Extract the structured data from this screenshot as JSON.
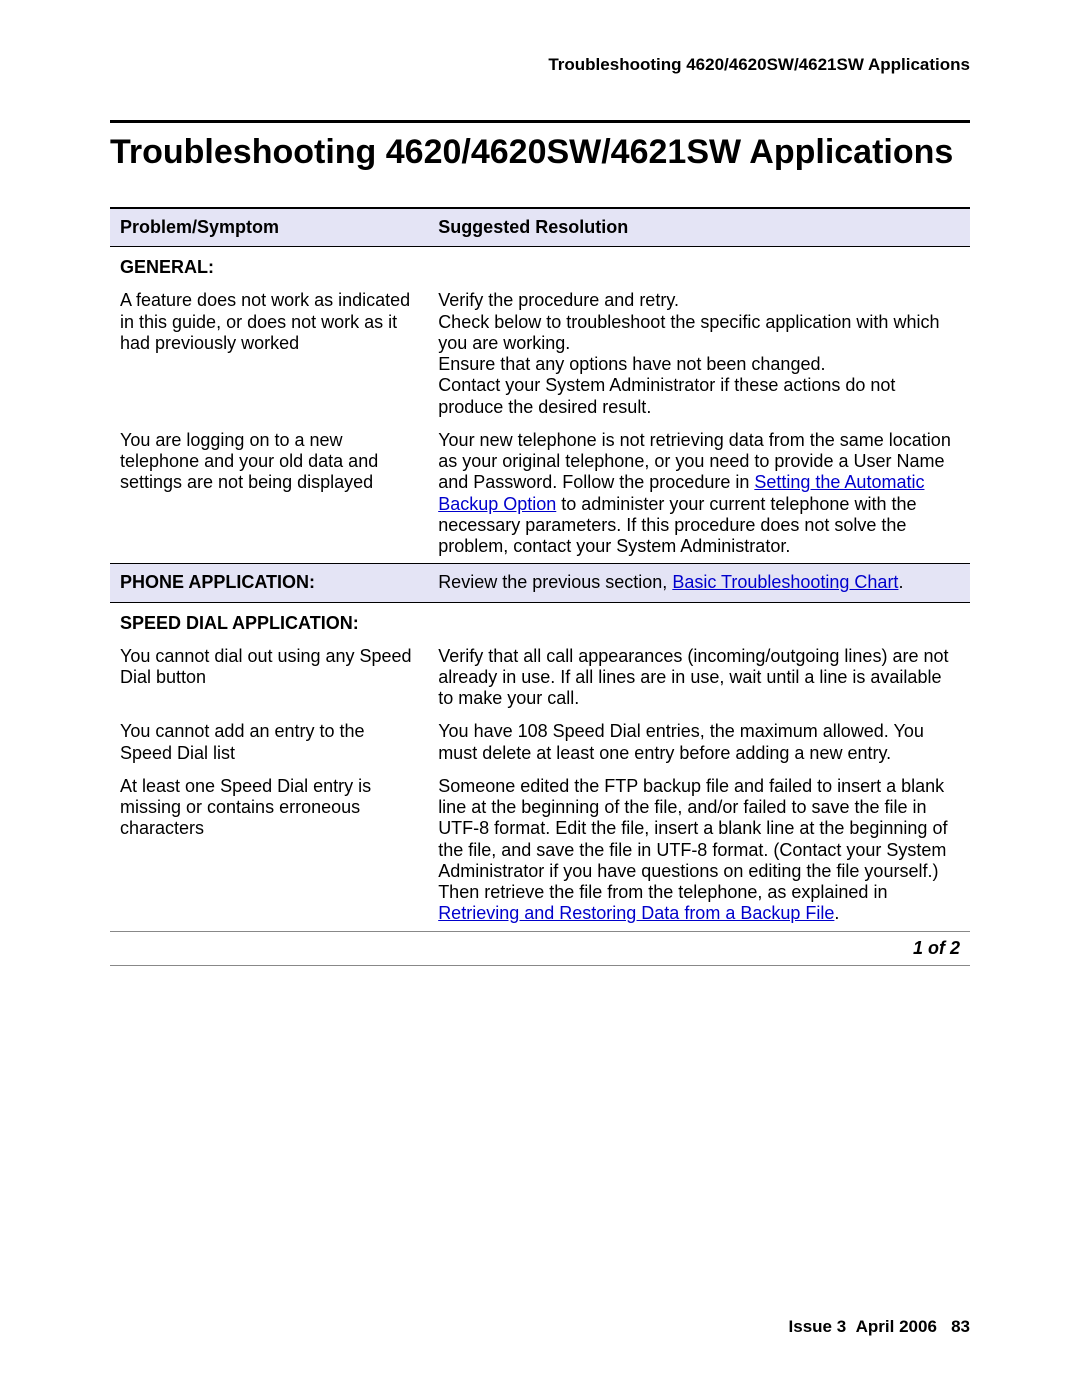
{
  "header": {
    "running": "Troubleshooting 4620/4620SW/4621SW Applications"
  },
  "title": "Troubleshooting 4620/4620SW/4621SW Applications",
  "table": {
    "headers": {
      "problem": "Problem/Symptom",
      "resolution": "Suggested Resolution"
    },
    "sections": {
      "general": "GENERAL:",
      "phone": "PHONE APPLICATION:",
      "speed": "SPEED DIAL APPLICATION:"
    },
    "rows": [
      {
        "problem": "A feature does not work as indicated in this guide, or does not work as it had previously worked",
        "resolution": "Verify the procedure and retry.\nCheck below to troubleshoot the specific application with which you are working.\nEnsure that any options have not been changed.\nContact your System Administrator if these actions do not produce the desired result."
      },
      {
        "problem": "You are logging on to a new telephone and your old data and settings are not being displayed",
        "resolution_pre": "Your new telephone is not retrieving data from the same location as your original telephone, or you need to provide a User Name and Password. Follow the procedure in ",
        "link1": "Setting the Automatic Backup Option",
        "resolution_post": " to administer your current telephone with the necessary parameters. If this procedure does not solve the problem, contact your System Administrator."
      },
      {
        "resolution_pre": "Review the previous section, ",
        "link1": "Basic Troubleshooting Chart",
        "resolution_post": "."
      },
      {
        "problem": "You cannot dial out using any Speed Dial button",
        "resolution": "Verify that all call appearances (incoming/outgoing lines) are not already in use. If all lines are in use, wait until a line is available to make your call."
      },
      {
        "problem": "You cannot add an entry to the Speed Dial list",
        "resolution": "You have 108 Speed Dial entries, the maximum allowed. You must delete at least one entry before adding a new entry."
      },
      {
        "problem": "At least one Speed Dial entry is missing or contains erroneous characters",
        "resolution_pre": "Someone edited the FTP backup file and failed to insert a blank line at the beginning of the file, and/or failed to save the file in UTF-8 format. Edit the file, insert a blank line at the beginning of the file, and save the file in UTF-8 format. (Contact your System Administrator if you have questions on editing the file yourself.) Then retrieve the file from the telephone, as explained in ",
        "link1": "Retrieving and Restoring Data from a Backup File",
        "resolution_post": "."
      }
    ],
    "pager": "1 of 2"
  },
  "footer": {
    "issue": "Issue 3",
    "date": "April 2006",
    "page": "83"
  }
}
